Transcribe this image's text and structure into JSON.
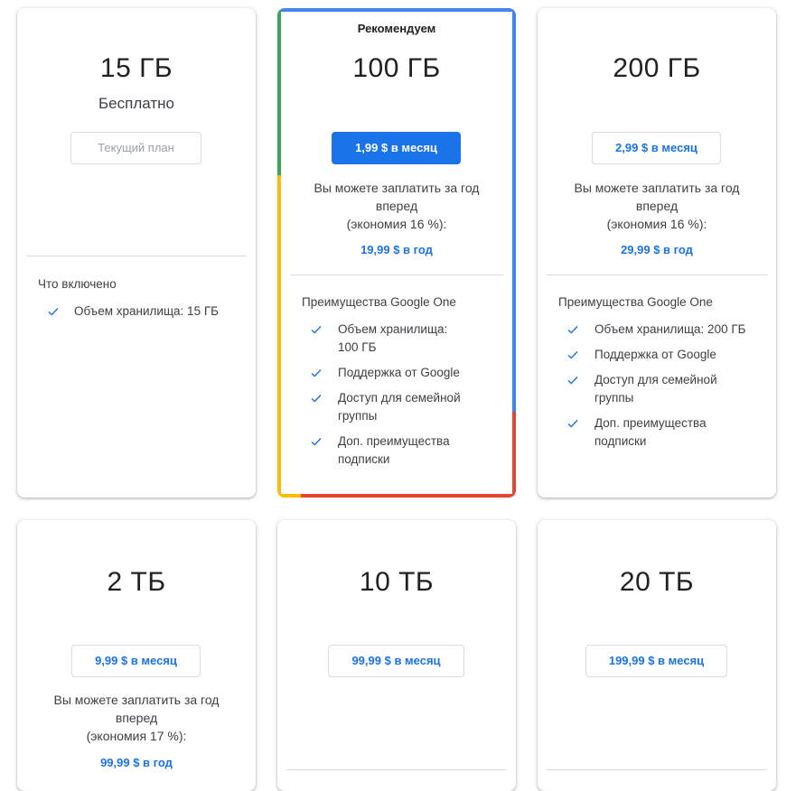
{
  "colors": {
    "accent": "#1a73e8",
    "google_green": "#34a853",
    "google_yellow": "#fbbc04",
    "google_red": "#ea4335",
    "google_blue": "#4285f4"
  },
  "plans": [
    {
      "size": "15 ГБ",
      "subtitle": "Бесплатно",
      "button": "Текущий план",
      "included_title": "Что включено",
      "features": [
        "Объем хранилища: 15 ГБ"
      ]
    },
    {
      "badge": "Рекомендуем",
      "size": "100 ГБ",
      "button": "1,99 $ в месяц",
      "yearly_line1": "Вы можете заплатить за год",
      "yearly_line2": "вперед",
      "yearly_line3": "(экономия 16 %):",
      "yearly_price": "19,99 $ в год",
      "benefits_title": "Преимущества Google One",
      "features": [
        [
          "Объем хранилища:",
          "100 ГБ"
        ],
        [
          "Поддержка от Google"
        ],
        [
          "Доступ для семейной",
          "группы"
        ],
        [
          "Доп. преимущества",
          "подписки"
        ]
      ]
    },
    {
      "size": "200 ГБ",
      "button": "2,99 $ в месяц",
      "yearly_line1": "Вы можете заплатить за год",
      "yearly_line2": "вперед",
      "yearly_line3": "(экономия 16 %):",
      "yearly_price": "29,99 $ в год",
      "benefits_title": "Преимущества Google One",
      "features": [
        [
          "Объем хранилища: 200 ГБ"
        ],
        [
          "Поддержка от Google"
        ],
        [
          "Доступ для семейной",
          "группы"
        ],
        [
          "Доп. преимущества",
          "подписки"
        ]
      ]
    },
    {
      "size": "2 ТБ",
      "button": "9,99 $ в месяц",
      "yearly_line1": "Вы можете заплатить за год",
      "yearly_line2": "вперед",
      "yearly_line3": "(экономия 17 %):",
      "yearly_price": "99,99 $ в год"
    },
    {
      "size": "10 ТБ",
      "button": "99,99 $ в месяц"
    },
    {
      "size": "20 ТБ",
      "button": "199,99 $ в месяц"
    }
  ]
}
